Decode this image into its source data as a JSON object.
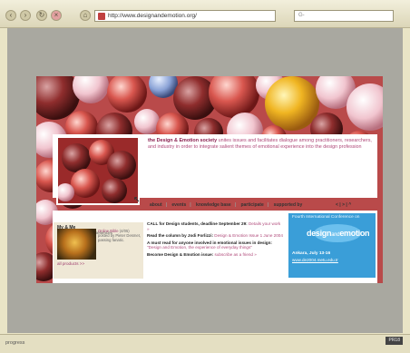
{
  "browser": {
    "url": "http://www.designandemotion.org/",
    "search_label": "G-",
    "status_left": "progress",
    "status_right": "PR18"
  },
  "site": {
    "intro_brand": "the Design & Emotion society",
    "intro_text": "unites issues and facilitates dialogue among practitioners, researchers, and industry in order to integrate salient themes of emotional experience into the design profession",
    "nav": [
      "about",
      "events",
      "knowledge base",
      "participate",
      "supported by"
    ],
    "nav_arrows": "< | > | ^",
    "corner_mark": "↖",
    "featured": {
      "title": "My & Me",
      "desc": "a forum on jewelry experiences",
      "caption_link": "Online Bible",
      "caption": "(4/05) posted by Pieter Desmet, passing fanatic.",
      "more": "all products >>"
    },
    "news": [
      {
        "lead": "CALL for Design students, deadline September 29:",
        "text": "Details your work »"
      },
      {
        "lead": "Read the column by Jodi Forlizzi:",
        "text": "Design & Emotion Issue 1 June 2004"
      },
      {
        "lead": "A must read for anyone involved in emotional issues in design:",
        "text": "\"Design and Emotion, the experience of everyday things\""
      },
      {
        "lead": "Become Design & Emotion issue:",
        "text": "subscribe as a friend »"
      }
    ],
    "conference": {
      "heading": "Fourth International Conference on",
      "logo_a": "design",
      "logo_b": "and",
      "logo_c": "emotion",
      "date": "Ankara, July 13-16",
      "link": "www.de2004.metu.edu.tr"
    }
  }
}
